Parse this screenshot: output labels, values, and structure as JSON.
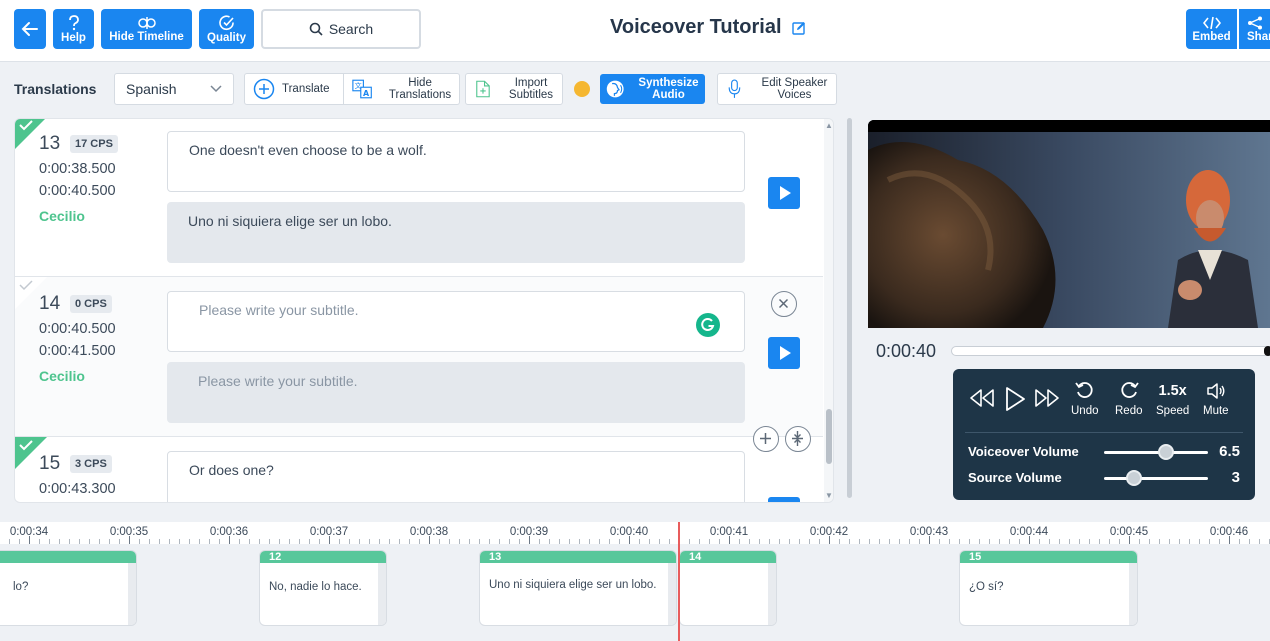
{
  "header": {
    "help_label": "Help",
    "hide_timeline_label": "Hide Timeline",
    "quality_label": "Quality",
    "search_label": "Search",
    "title": "Voiceover Tutorial",
    "embed_label": "Embed",
    "share_label": "Share"
  },
  "toolbar": {
    "translations_label": "Translations",
    "language": "Spanish",
    "translate_label": "Translate",
    "hide_translations_label": "Hide Translations",
    "import_subtitles_label": "Import Subtitles",
    "synthesize_audio_label": "Synthesize Audio",
    "edit_speaker_voices_label": "Edit Speaker Voices",
    "status_color": "#f5b731"
  },
  "subtitles": [
    {
      "number": "13",
      "cps": "17 CPS",
      "start": "0:00:38.500",
      "end": "0:00:40.500",
      "speaker": "Cecilio",
      "source": "One doesn't even choose to be a wolf.",
      "target": "Uno ni siquiera elige ser un lobo."
    },
    {
      "number": "14",
      "cps": "0 CPS",
      "start": "0:00:40.500",
      "end": "0:00:41.500",
      "speaker": "Cecilio",
      "source_placeholder": "Please write your subtitle.",
      "target_placeholder": "Please write your subtitle."
    },
    {
      "number": "15",
      "cps": "3 CPS",
      "start": "0:00:43.300",
      "source": "Or does one?"
    }
  ],
  "player": {
    "current_time": "0:00:40",
    "undo_label": "Undo",
    "redo_label": "Redo",
    "speed_value": "1.5x",
    "speed_label": "Speed",
    "mute_label": "Mute",
    "voiceover_volume_label": "Voiceover Volume",
    "voiceover_volume": "6.5",
    "source_volume_label": "Source Volume",
    "source_volume": "3"
  },
  "timeline": {
    "ticks": [
      "0:00:34",
      "0:00:35",
      "0:00:36",
      "0:00:37",
      "0:00:38",
      "0:00:39",
      "0:00:40",
      "0:00:41",
      "0:00:42",
      "0:00:43",
      "0:00:44",
      "0:00:45",
      "0:00:46"
    ],
    "cues": [
      {
        "number": "",
        "text": "lo?"
      },
      {
        "number": "12",
        "text": "No, nadie lo hace."
      },
      {
        "number": "13",
        "text": "Uno ni siquiera elige ser un lobo."
      },
      {
        "number": "14",
        "text": ""
      },
      {
        "number": "15",
        "text": "¿O sí?"
      }
    ]
  }
}
